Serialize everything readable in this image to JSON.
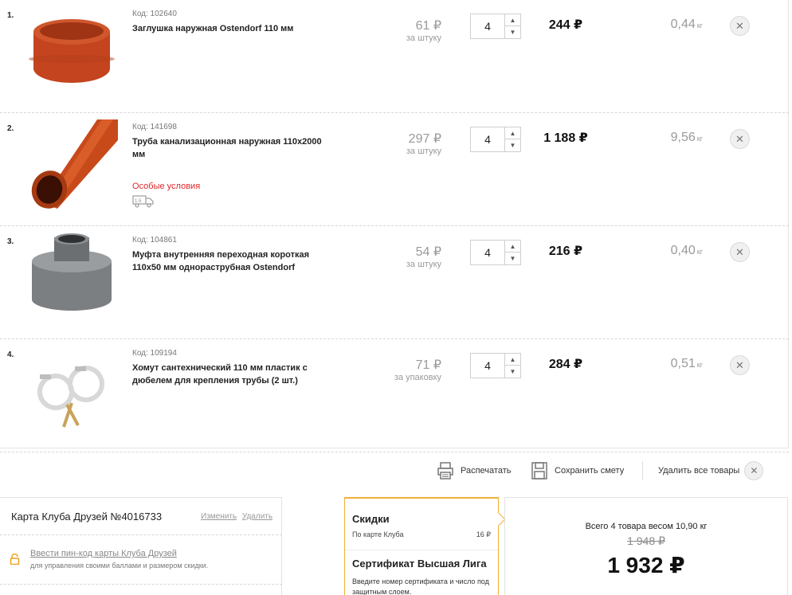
{
  "cart": {
    "items": [
      {
        "num": "1.",
        "code": "Код: 102640",
        "name": "Заглушка наружная Ostendorf 110 мм",
        "special": "",
        "price": "61 ₽",
        "unit": "за штуку",
        "qty": "4",
        "total": "244 ₽",
        "weight": "0,44",
        "weight_unit": "кг",
        "color": "#c4441f"
      },
      {
        "num": "2.",
        "code": "Код: 141698",
        "name": "Труба канализационная наружная 110x2000 мм",
        "special": "Особые условия",
        "price": "297 ₽",
        "unit": "за штуку",
        "qty": "4",
        "total": "1 188 ₽",
        "weight": "9,56",
        "weight_unit": "кг",
        "color": "#c84a1a"
      },
      {
        "num": "3.",
        "code": "Код: 104861",
        "name": "Муфта внутренняя переходная короткая 110x50 мм однораструбная Ostendorf",
        "special": "",
        "price": "54 ₽",
        "unit": "за штуку",
        "qty": "4",
        "total": "216 ₽",
        "weight": "0,40",
        "weight_unit": "кг",
        "color": "#7c7f82"
      },
      {
        "num": "4.",
        "code": "Код: 109194",
        "name": "Хомут сантехнический 110 мм пластик с дюбелем для крепления трубы (2 шт.)",
        "special": "",
        "price": "71 ₽",
        "unit": "за упаковку",
        "qty": "4",
        "total": "284 ₽",
        "weight": "0,51",
        "weight_unit": "кг",
        "color": "#d8d8d8"
      }
    ]
  },
  "actions": {
    "print_label": "Распечатать",
    "save_label": "Сохранить смету",
    "remove_all_label": "Удалить все товары"
  },
  "club": {
    "title": "Карта Клуба Друзей №4016733",
    "change": "Изменить",
    "delete": "Удалить",
    "pin_link": "Ввести пин-код карты Клуба Друзей",
    "pin_sub": "для управления своими баллами и размером скидки."
  },
  "discounts": {
    "title": "Скидки",
    "club_label": "По карте Клуба",
    "club_value": "16 ₽",
    "cert_title": "Сертификат Высшая Лига",
    "cert_text": "Введите номер сертификата и число под защитным слоем."
  },
  "summary": {
    "text": "Всего 4 товара весом 10,90 кг",
    "old_total": "1 948 ₽",
    "new_total": "1 932 ₽"
  },
  "colors": {
    "accent": "#f0b13a",
    "special": "#e0272a"
  }
}
